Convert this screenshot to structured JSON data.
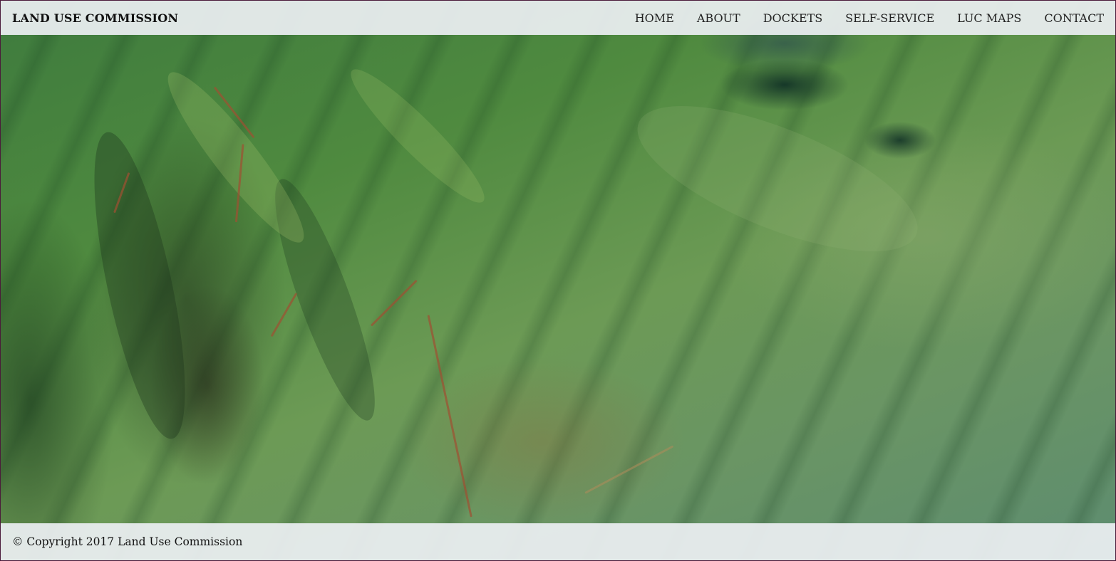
{
  "header": {
    "site_title": "LAND USE COMMISSION",
    "nav": [
      {
        "label": "HOME"
      },
      {
        "label": "ABOUT"
      },
      {
        "label": "DOCKETS"
      },
      {
        "label": "SELF-SERVICE"
      },
      {
        "label": "LUC MAPS"
      },
      {
        "label": "CONTACT"
      }
    ]
  },
  "hero": {
    "image": "aerial-mountain-landscape"
  },
  "footer": {
    "copyright": "© Copyright 2017 Land Use Commission"
  },
  "colors": {
    "bar_background": "#eceff2",
    "text": "#111111",
    "frame": "#4a1a3a"
  }
}
